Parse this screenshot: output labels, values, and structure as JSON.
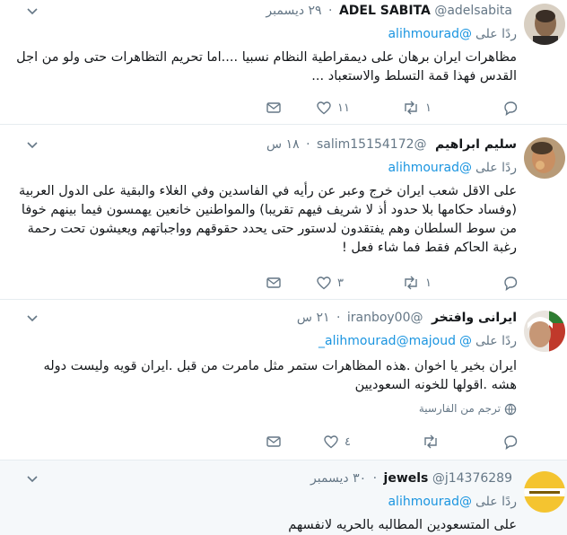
{
  "reply_prefix": "ردًا على",
  "tweets": [
    {
      "name": "ADEL SABITA",
      "handle": "@adelsabita",
      "separator": "·",
      "time": "٢٩ ديسمبر",
      "mentions": [
        "@alihmourad"
      ],
      "text": "مظاهرات ايران برهان على ديمقراطية النظام نسبيا ....اما تحريم التظاهرات حتى ولو من اجل القدس فهذا قمة التسلط والاستعباد ...",
      "replies": "",
      "retweets": "١",
      "likes": "١١"
    },
    {
      "name": "سليم ابراهيم",
      "handle": "@salim15154172",
      "separator": "·",
      "time": "١٨ س",
      "mentions": [
        "@alihmourad"
      ],
      "text": "على الاقل شعب ايران خرج وعبر عن رأيه في الفاسدين وفي الغلاء والبقية على الدول العربية (وفساد حكامها بلا حدود أذ لا شريف فيهم تقريبا) والمواطنين خانعين يهمسون فيما بينهم خوفا من سوط السلطان وهم يفتقدون لدستور حتى يحدد حقوقهم وواجباتهم ويعيشون تحت رحمة رغبة الحاكم فقط فما شاء فعل !",
      "replies": "",
      "retweets": "١",
      "likes": "٣"
    },
    {
      "name": "ايرانى وافتخر",
      "handle": "@iranboy00",
      "separator": "·",
      "time": "٢١ س",
      "mentions": [
        "@alihmourad",
        "@majoud_"
      ],
      "text": "ايران بخير يا اخوان .هذه المظاهرات ستمر مثل مامرت من قبل .ايران قويه وليست دوله هشه .اقولها للخونه السعوديين",
      "translate": "ترجم من الفارسية",
      "replies": "",
      "retweets": "",
      "likes": "٤"
    },
    {
      "name": "jewels",
      "handle": "@j14376289",
      "separator": "·",
      "time": "٣٠ ديسمبر",
      "mentions": [
        "@alihmourad"
      ],
      "text": "على المتسعودين المطالبه بالحريه لانفسهم"
    }
  ]
}
